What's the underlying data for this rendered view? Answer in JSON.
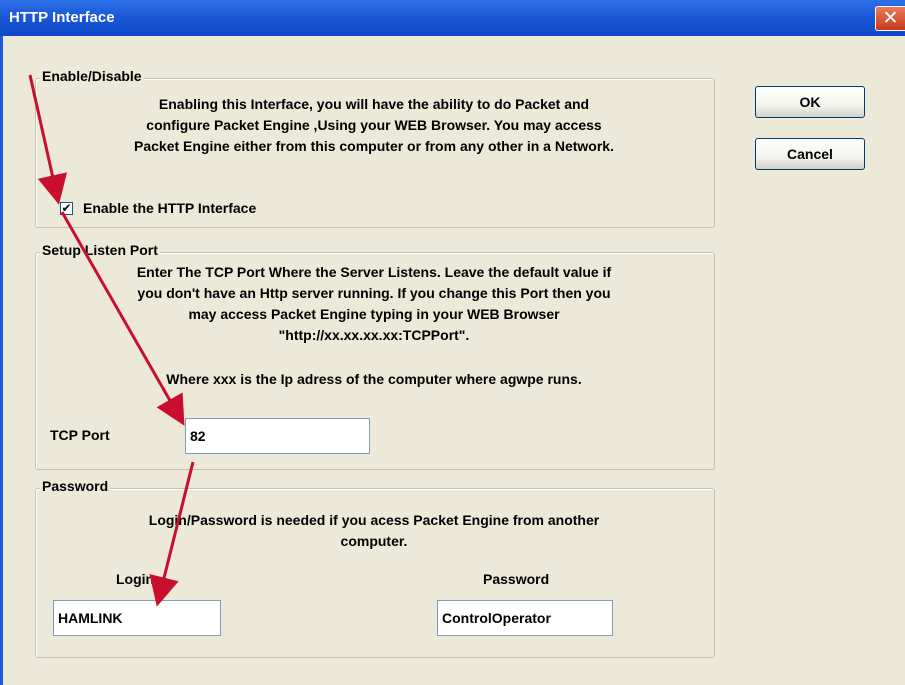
{
  "window": {
    "title": "HTTP Interface",
    "close_glyph": "✕"
  },
  "buttons": {
    "ok_label": "OK",
    "cancel_label": "Cancel"
  },
  "enable_group": {
    "legend": "Enable/Disable",
    "desc_lines": [
      "Enabling this Interface, you will have the ability to do Packet and",
      "configure Packet Engine  ,Using your WEB Browser. You may access",
      "Packet Engine either from this computer or from any other in a Network."
    ],
    "checkbox_label": "Enable the HTTP Interface",
    "checkbox_checked_glyph": "✔"
  },
  "port_group": {
    "legend": "Setup Listen Port",
    "desc_lines": [
      "Enter The TCP Port Where the Server Listens. Leave the default value if",
      "you don't have an Http server running. If you change this Port then you",
      "may access Packet Engine typing in your WEB Browser",
      "\"http://xx.xx.xx.xx:TCPPort\".",
      "Where xxx is the Ip adress of the computer where agwpe runs."
    ],
    "port_label": "TCP Port",
    "port_value": "82"
  },
  "password_group": {
    "legend": "Password",
    "desc_lines": [
      "Login/Password is needed if you acess Packet Engine from another",
      "computer."
    ],
    "login_label": "Login",
    "login_value": "HAMLINK",
    "password_label": "Password",
    "password_value": "ControlOperator"
  },
  "colors": {
    "titlebar": "#0b47c8",
    "dialog_bg": "#ece9d8",
    "arrow": "#c8102e"
  }
}
